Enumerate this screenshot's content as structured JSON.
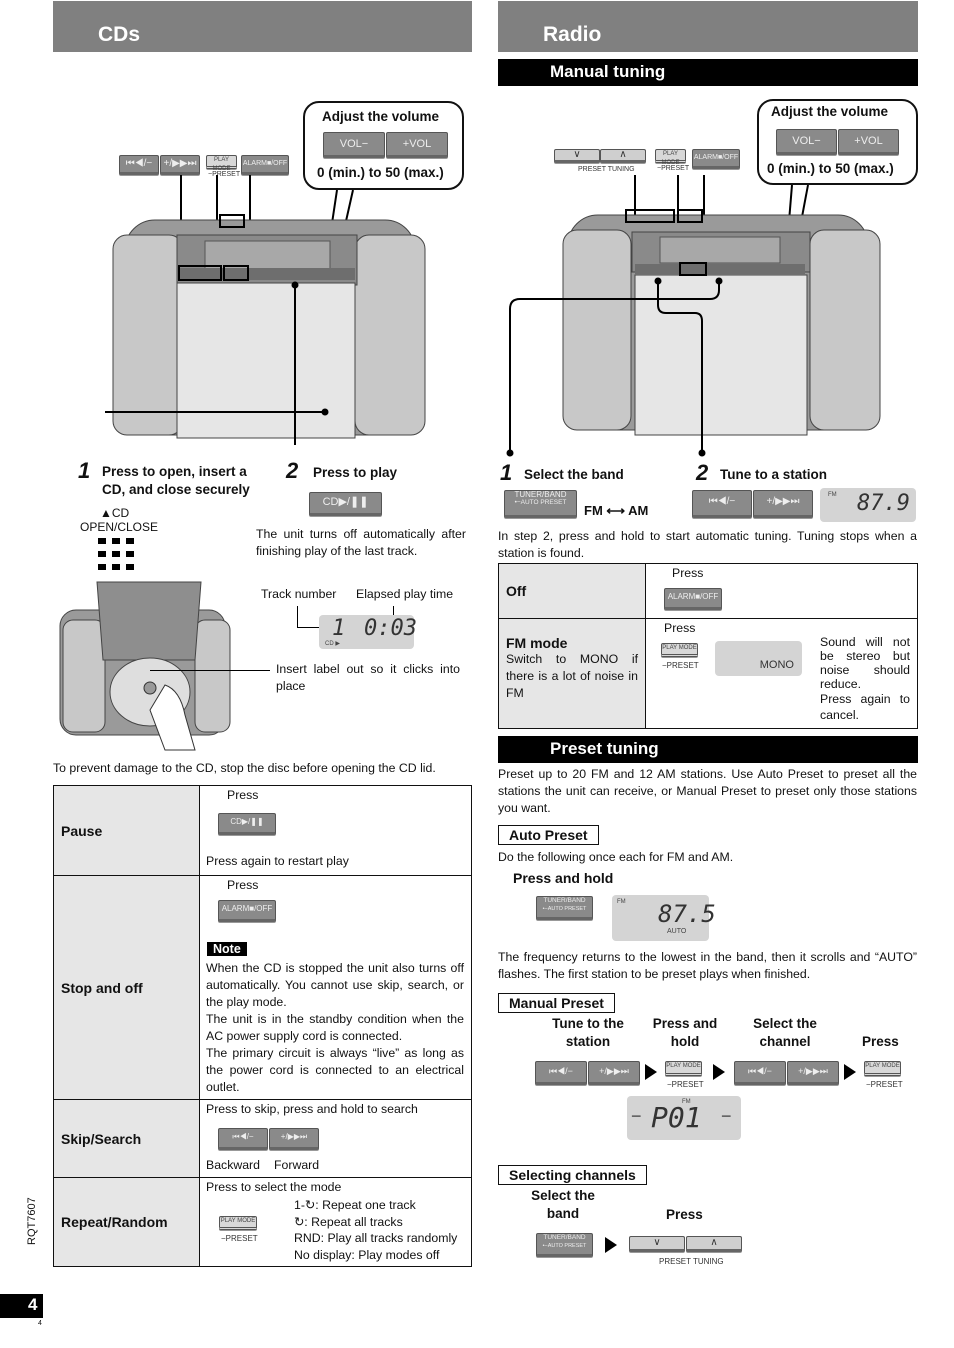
{
  "cds": {
    "title": "CDs",
    "device_buttons": {
      "skip_back": "⏮◀/−",
      "skip_fwd": "+/▶▶⏭",
      "play_mode": "PLAY MODE",
      "preset_cap": "−PRESET",
      "alarm_off": "ALARM■/OFF"
    },
    "volume_bubble": {
      "title": "Adjust the volume",
      "vol_down": "VOL−",
      "vol_up": "+VOL",
      "range": "0 (min.) to 50 (max.)"
    },
    "step1": {
      "num": "1",
      "text": "Press to open, insert a CD, and close securely",
      "eject_label": "▲CD",
      "eject_label2": "OPEN/CLOSE"
    },
    "step2": {
      "num": "2",
      "text": "Press to play",
      "button": "CD▶/❚❚",
      "note": "The unit turns off automatically after finishing play of the last track."
    },
    "display": {
      "track_label": "Track number",
      "time_label": "Elapsed play time",
      "track": "1",
      "time": "0:03",
      "indicator": "CD ▶"
    },
    "insert_note": "Insert label out so it clicks into place",
    "warning": "To prevent damage to the CD, stop the disc before opening the CD lid.",
    "table": [
      {
        "label": "Pause",
        "press": "Press",
        "button": "CD▶/❚❚",
        "after": "Press again to restart play"
      },
      {
        "label": "Stop and off",
        "press": "Press",
        "button": "ALARM■/OFF",
        "note_title": "Note",
        "note_lines": [
          "When the CD is stopped the unit also turns off automatically. You cannot use skip, search, or the play mode.",
          "The unit is in the standby condition when the AC power supply cord is connected.",
          "The primary circuit is always “live” as long as the power cord is connected to an electrical outlet."
        ]
      },
      {
        "label": "Skip/Search",
        "intro": "Press to skip, press and hold to search",
        "btn_back": "⏮◀/−",
        "btn_fwd": "+/▶▶⏭",
        "back": "Backward",
        "fwd": "Forward"
      },
      {
        "label": "Repeat/Random",
        "intro": "Press to select the mode",
        "button": "PLAY MODE",
        "button_cap": "−PRESET",
        "modes": [
          "1-↻: Repeat one track",
          "↻: Repeat all tracks",
          "RND: Play all tracks randomly",
          "No display: Play modes off"
        ]
      }
    ]
  },
  "radio": {
    "title": "Radio",
    "manual_tuning": {
      "heading": "Manual tuning",
      "device_buttons": {
        "down": "∨",
        "up": "∧",
        "preset_tuning": "PRESET TUNING",
        "play_mode": "PLAY MODE",
        "preset_cap": "−PRESET",
        "alarm_off": "ALARM■/OFF"
      },
      "volume_bubble": {
        "title": "Adjust the volume",
        "vol_down": "VOL−",
        "vol_up": "+VOL",
        "range": "0 (min.) to 50 (max.)"
      },
      "step1": {
        "num": "1",
        "text": "Select the band",
        "button_line1": "TUNER/BAND",
        "button_line2": "•−AUTO PRESET",
        "bands": "FM ⟷ AM"
      },
      "step2": {
        "num": "2",
        "text": "Tune to a station",
        "btn_back": "⏮◀/−",
        "btn_fwd": "+/▶▶⏭",
        "band": "FM",
        "freq": "87.9"
      },
      "auto_note": "In step 2, press and hold to start automatic tuning. Tuning stops when a station is found.",
      "table": [
        {
          "label": "Off",
          "press": "Press",
          "button": "ALARM■/OFF"
        },
        {
          "label": "FM mode",
          "sublabel": "Switch to MONO if there is a lot of noise in FM",
          "press": "Press",
          "button": "PLAY MODE",
          "button_cap": "−PRESET",
          "display": "MONO",
          "desc": "Sound will not be stereo but noise should reduce.",
          "desc2": "Press again to cancel."
        }
      ]
    },
    "preset_tuning": {
      "heading": "Preset tuning",
      "intro": "Preset up to 20 FM and 12 AM stations. Use Auto Preset to preset all the stations the unit can receive, or Manual Preset to preset only those stations you want.",
      "auto": {
        "label": "Auto Preset",
        "note": "Do the following once each for FM and AM.",
        "action": "Press and hold",
        "button_line1": "TUNER/BAND",
        "button_line2": "•−AUTO PRESET",
        "band": "FM",
        "freq": "87.5",
        "flash": "AUTO",
        "after": "The frequency returns to the lowest in the band, then it scrolls and “AUTO” flashes. The first station to be preset plays when finished."
      },
      "manual": {
        "label": "Manual Preset",
        "steps": [
          "Tune to the station",
          "Press and hold",
          "Select the channel",
          "Press"
        ],
        "btn_back": "⏮◀/−",
        "btn_fwd": "+/▶▶⏭",
        "play_mode": "PLAY MODE",
        "preset_cap": "−PRESET",
        "display_band": "FM",
        "display": "P01"
      },
      "selecting": {
        "label": "Selecting channels",
        "step1": "Select the band",
        "step2": "Press",
        "button_line1": "TUNER/BAND",
        "button_line2": "•−AUTO PRESET",
        "down": "∨",
        "up": "∧",
        "preset_tuning": "PRESET TUNING"
      }
    }
  },
  "footer": {
    "doc_code": "RQT7607",
    "page": "4",
    "page_small": "4"
  }
}
